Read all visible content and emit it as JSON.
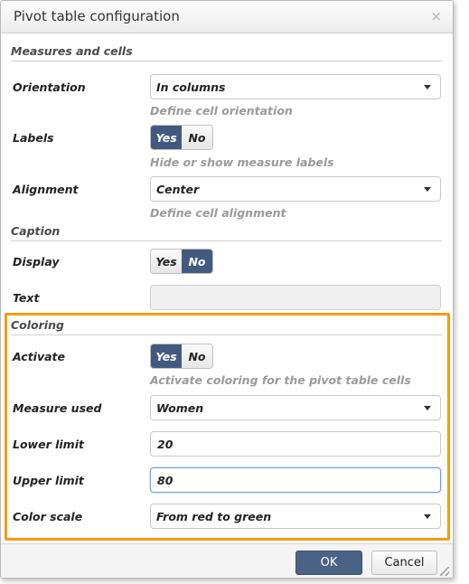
{
  "window": {
    "title": "Pivot table configuration",
    "close_glyph": "×"
  },
  "measures_section": {
    "title": "Measures and cells",
    "orientation": {
      "label": "Orientation",
      "value": "In columns",
      "hint": "Define cell orientation"
    },
    "labels": {
      "label": "Labels",
      "yes": "Yes",
      "no": "No",
      "selected": "Yes",
      "hint": "Hide or show measure labels"
    },
    "alignment": {
      "label": "Alignment",
      "value": "Center",
      "hint": "Define cell alignment"
    }
  },
  "caption_section": {
    "title": "Caption",
    "display": {
      "label": "Display",
      "yes": "Yes",
      "no": "No",
      "selected": "No"
    },
    "text": {
      "label": "Text",
      "value": ""
    }
  },
  "coloring_section": {
    "title": "Coloring",
    "activate": {
      "label": "Activate",
      "yes": "Yes",
      "no": "No",
      "selected": "Yes",
      "hint": "Activate coloring for the pivot table cells"
    },
    "measure_used": {
      "label": "Measure used",
      "value": "Women"
    },
    "lower_limit": {
      "label": "Lower limit",
      "value": "20"
    },
    "upper_limit": {
      "label": "Upper limit",
      "value": "80"
    },
    "color_scale": {
      "label": "Color scale",
      "value": "From red to green"
    }
  },
  "footer": {
    "ok_label": "OK",
    "cancel_label": "Cancel"
  },
  "colors": {
    "toggle_active": "#435a80",
    "highlight": "#f39c12",
    "ok_button": "#4b6287"
  }
}
